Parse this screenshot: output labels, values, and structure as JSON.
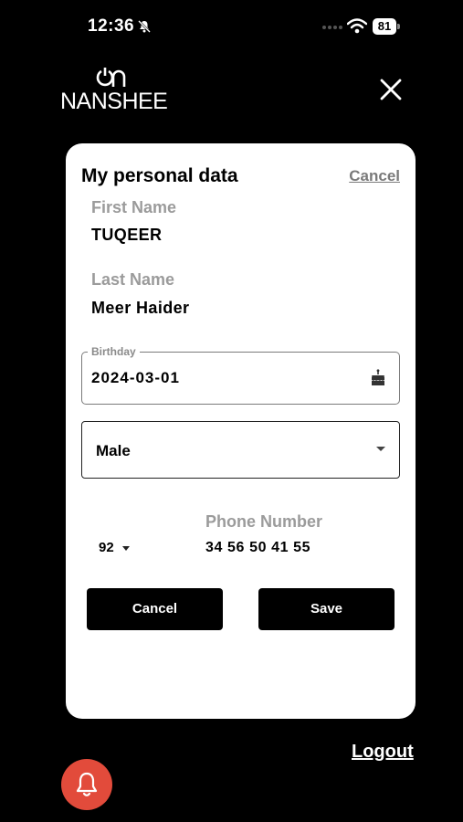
{
  "status_bar": {
    "time": "12:36",
    "battery": "81",
    "icons": [
      "mute-icon",
      "signal-dots",
      "wifi-icon",
      "battery-icon"
    ]
  },
  "header": {
    "brand_name": "NANSHEE",
    "close_icon": "close-icon"
  },
  "personal_data": {
    "title": "My personal data",
    "cancel_link": "Cancel",
    "first_name": {
      "label": "First Name",
      "value": "TUQEER"
    },
    "last_name": {
      "label": "Last Name",
      "value": "Meer Haider"
    },
    "birthday": {
      "label": "Birthday",
      "value": "2024-03-01",
      "icon": "cake-icon"
    },
    "gender": {
      "value": "Male"
    },
    "phone": {
      "country_code": "92",
      "label": "Phone Number",
      "value": "34 56 50 41 55"
    },
    "buttons": {
      "cancel": "Cancel",
      "save": "Save"
    }
  },
  "footer": {
    "logout": "Logout",
    "bell_icon": "bell-icon"
  },
  "colors": {
    "background": "#000000",
    "card": "#ffffff",
    "primary_button": "#000000",
    "muted_label": "#9b9b9b",
    "notification": "#e24b3b"
  }
}
